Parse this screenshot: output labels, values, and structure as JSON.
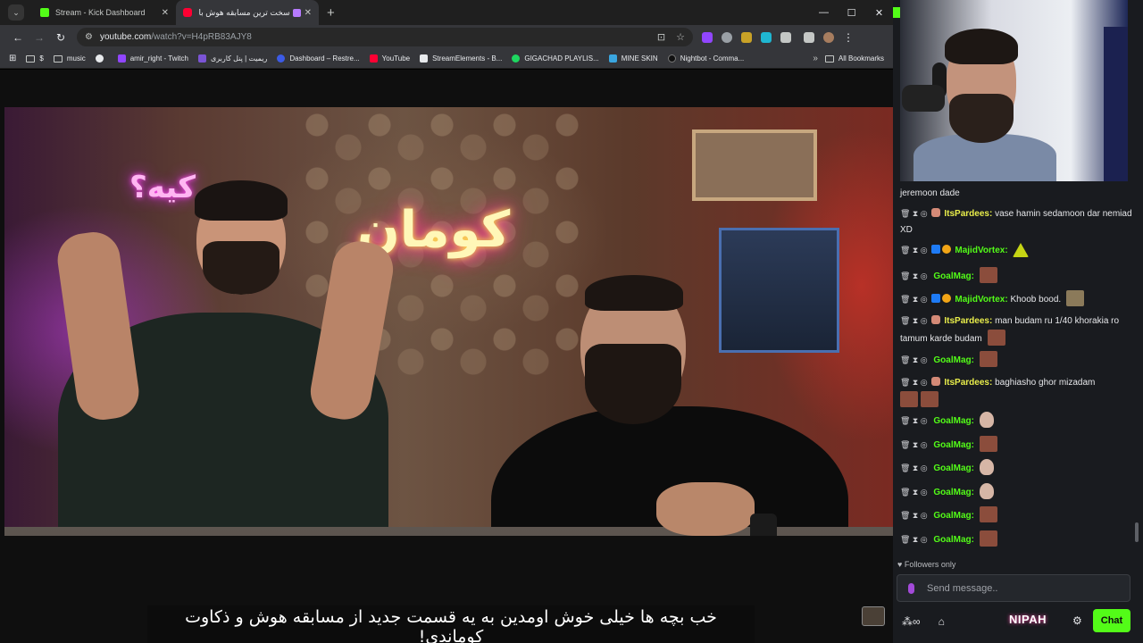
{
  "browser": {
    "tabs": [
      {
        "title": "Stream - Kick Dashboard",
        "favicon": "kick-icon"
      },
      {
        "title": "سخت ترین مسابقه هوش با ...",
        "favicon": "youtube-icon"
      }
    ],
    "new_tab": "+",
    "window_controls": {
      "minimize": "—",
      "maximize": "☐",
      "close": "✕"
    },
    "url_host": "youtube.com",
    "url_path": "/watch?v=H4pRB83AJY8",
    "bookmarks": [
      {
        "label": "$",
        "icon": "folder-icon"
      },
      {
        "label": "music",
        "icon": "folder-icon"
      },
      {
        "label": "",
        "icon": "globe-icon"
      },
      {
        "label": "amir_right - Twitch",
        "icon": "twitch-icon"
      },
      {
        "label": "ریمیت | پنل کاربری",
        "icon": "remit-icon"
      },
      {
        "label": "Dashboard – Restre...",
        "icon": "restream-icon"
      },
      {
        "label": "YouTube",
        "icon": "youtube-icon"
      },
      {
        "label": "StreamElements - B...",
        "icon": "streamelements-icon"
      },
      {
        "label": "GIGACHAD PLAYLIS...",
        "icon": "spotify-icon"
      },
      {
        "label": "MINE SKIN",
        "icon": "mineskin-icon"
      },
      {
        "label": "Nightbot - Comma...",
        "icon": "nightbot-icon"
      }
    ],
    "bookmarks_more": "»",
    "all_bookmarks": "All Bookmarks"
  },
  "video": {
    "subtitle": "خب بچه ها خیلی خوش اومدین به یه قسمت جدید از مسابقه هوش و ذکاوت کوماندی!",
    "neon_main": "کومان",
    "neon_pink": "کیه؟"
  },
  "chat": {
    "messages": [
      {
        "user": "",
        "text": "jeremoon dade",
        "user_color": "",
        "emotes": []
      },
      {
        "user": "ItsPardees:",
        "text": "vase hamin sedamoon dar nemiad XD",
        "user_color": "yellow",
        "emotes": []
      },
      {
        "user": "MajidVortex:",
        "text": "",
        "user_color": "green",
        "emotes": [
          "triangle"
        ]
      },
      {
        "user": "GoalMag:",
        "text": "",
        "user_color": "green",
        "emotes": [
          "face"
        ]
      },
      {
        "user": "MajidVortex:",
        "text": "Khoob bood.",
        "user_color": "green",
        "emotes": [
          "dog"
        ]
      },
      {
        "user": "ItsPardees:",
        "text": "man budam ru 1/40 khorakia ro tamum karde budam",
        "user_color": "yellow",
        "emotes": [
          "face"
        ]
      },
      {
        "user": "GoalMag:",
        "text": "",
        "user_color": "green",
        "emotes": [
          "face"
        ]
      },
      {
        "user": "ItsPardees:",
        "text": "baghiasho ghor mizadam",
        "user_color": "yellow",
        "emotes": [
          "face",
          "face"
        ]
      },
      {
        "user": "GoalMag:",
        "text": "",
        "user_color": "green",
        "emotes": [
          "egg"
        ]
      },
      {
        "user": "GoalMag:",
        "text": "",
        "user_color": "green",
        "emotes": [
          "face"
        ]
      },
      {
        "user": "GoalMag:",
        "text": "",
        "user_color": "green",
        "emotes": [
          "egg"
        ]
      },
      {
        "user": "GoalMag:",
        "text": "",
        "user_color": "green",
        "emotes": [
          "egg"
        ]
      },
      {
        "user": "GoalMag:",
        "text": "",
        "user_color": "green",
        "emotes": [
          "face"
        ]
      },
      {
        "user": "GoalMag:",
        "text": "",
        "user_color": "green",
        "emotes": [
          "face"
        ]
      }
    ],
    "followers_only": "Followers only",
    "input_placeholder": "Send message..",
    "brand": "NIPAH",
    "chat_button": "Chat"
  },
  "colors": {
    "kick_green": "#53fc18",
    "youtube_red": "#ff0033",
    "panel": "#191b1f"
  }
}
